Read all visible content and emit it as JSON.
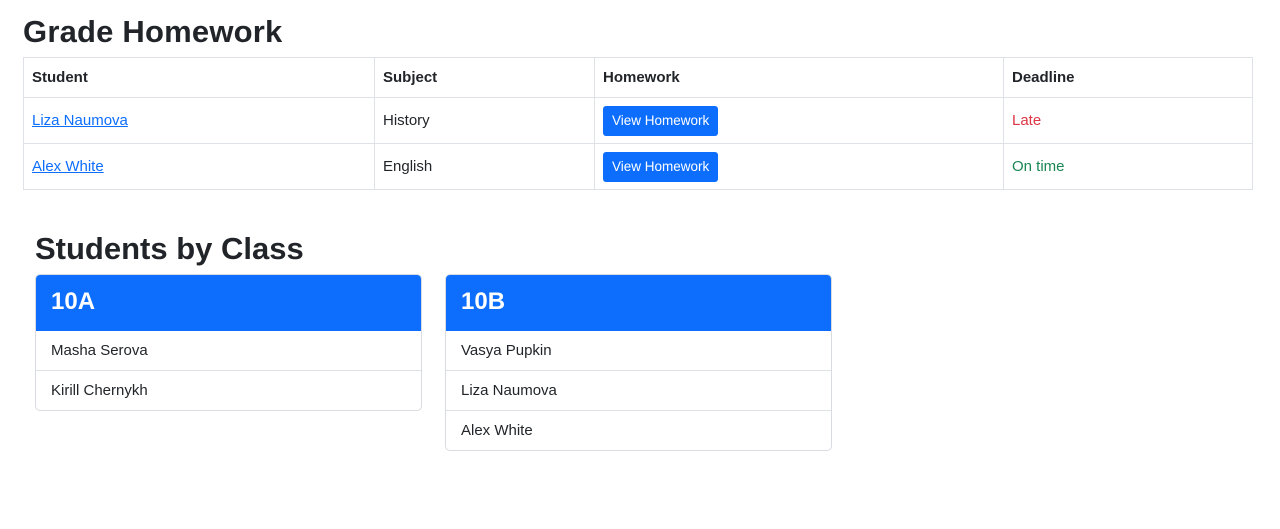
{
  "grade_section": {
    "title": "Grade Homework",
    "headers": [
      "Student",
      "Subject",
      "Homework",
      "Deadline"
    ],
    "rows": [
      {
        "student": "Liza Naumova",
        "subject": "History",
        "button": "View Homework",
        "deadline": "Late",
        "deadline_color": "#dc3545"
      },
      {
        "student": "Alex White",
        "subject": "English",
        "button": "View Homework",
        "deadline": "On time",
        "deadline_color": "#198754"
      }
    ]
  },
  "class_section": {
    "title": "Students by Class",
    "classes": [
      {
        "name": "10A",
        "students": [
          "Masha Serova",
          "Kirill Chernykh"
        ]
      },
      {
        "name": "10B",
        "students": [
          "Vasya Pupkin",
          "Liza Naumova",
          "Alex White"
        ]
      }
    ]
  },
  "colors": {
    "primary": "#0d6efd",
    "danger": "#dc3545",
    "success": "#198754"
  }
}
